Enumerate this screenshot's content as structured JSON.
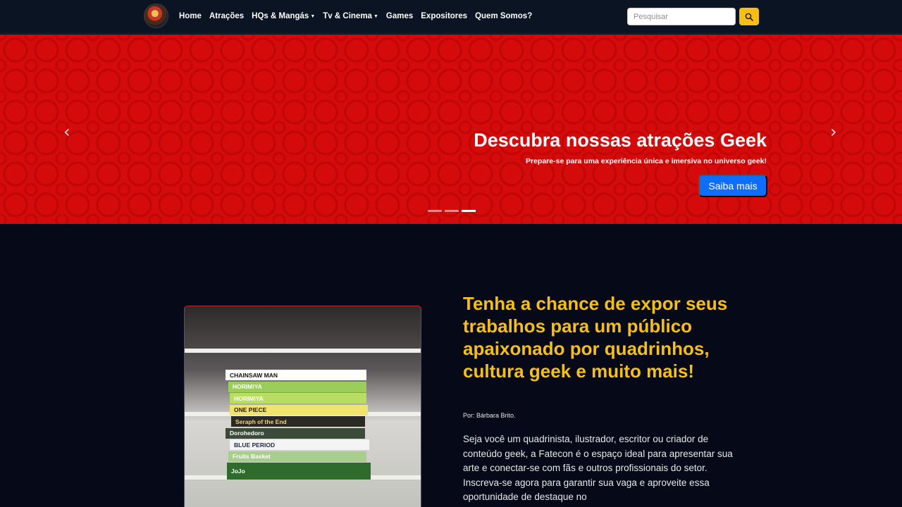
{
  "nav": {
    "logo_icon": "geek-logo-icon",
    "items": [
      {
        "label": "Home",
        "dropdown": false
      },
      {
        "label": "Atrações",
        "dropdown": false
      },
      {
        "label": "HQs & Mangás",
        "dropdown": true
      },
      {
        "label": "Tv & Cinema",
        "dropdown": true
      },
      {
        "label": "Games",
        "dropdown": false
      },
      {
        "label": "Expositores",
        "dropdown": false
      },
      {
        "label": "Quem Somos?",
        "dropdown": false
      }
    ],
    "search_placeholder": "Pesquisar",
    "search_icon": "search-icon"
  },
  "carousel": {
    "title": "Descubra nossas atrações Geek",
    "subtitle": "Prepare-se para uma experiência única e imersiva no universo geek!",
    "button_label": "Saiba mais",
    "prev_icon": "chevron-left-icon",
    "next_icon": "chevron-right-icon",
    "slide_count": 3,
    "active_slide": 3
  },
  "feature": {
    "headline": "Tenha a chance de expor seus trabalhos para um público apaixonado por quadrinhos, cultura geek e muito mais!",
    "byline": "Por: Bárbara Brito.",
    "body": "Seja você um quadrinista, ilustrador, escritor ou criador de conteúdo geek, a Fatecon é o espaço ideal para apresentar sua arte e conectar-se com fãs e outros profissionais do setor. Inscreva-se agora para garantir sua vaga e aproveite essa oportunidade de destaque no",
    "book_spines": [
      {
        "title": "CHAINSAW MAN",
        "bg": "#ffffff",
        "fg": "#111111"
      },
      {
        "title": "HORIMIYA",
        "bg": "#9acd5a",
        "fg": "#ffffff"
      },
      {
        "title": "HORIMIYA",
        "bg": "#b9dc62",
        "fg": "#ffffff"
      },
      {
        "title": "ONE PIECE",
        "bg": "#f2e36a",
        "fg": "#1a1a1a"
      },
      {
        "title": "Seraph of the End",
        "bg": "#2a2a22",
        "fg": "#f5d37a"
      },
      {
        "title": "Dorohedoro",
        "bg": "#3b4a39",
        "fg": "#ffffff"
      },
      {
        "title": "BLUE PERIOD",
        "bg": "#f4f4f4",
        "fg": "#1f2a44"
      },
      {
        "title": "Fruits Basket",
        "bg": "#a7cf8c",
        "fg": "#ffffff"
      },
      {
        "title": "JoJo",
        "bg": "#2f6b2a",
        "fg": "#ffffff"
      }
    ],
    "photo_border_color": "#c2272d"
  },
  "colors": {
    "nav_bg": "#0b1423",
    "page_bg": "#060a18",
    "accent_yellow": "#f7be16",
    "carousel_red": "#d50a0a",
    "primary_button": "#0d6efd"
  }
}
